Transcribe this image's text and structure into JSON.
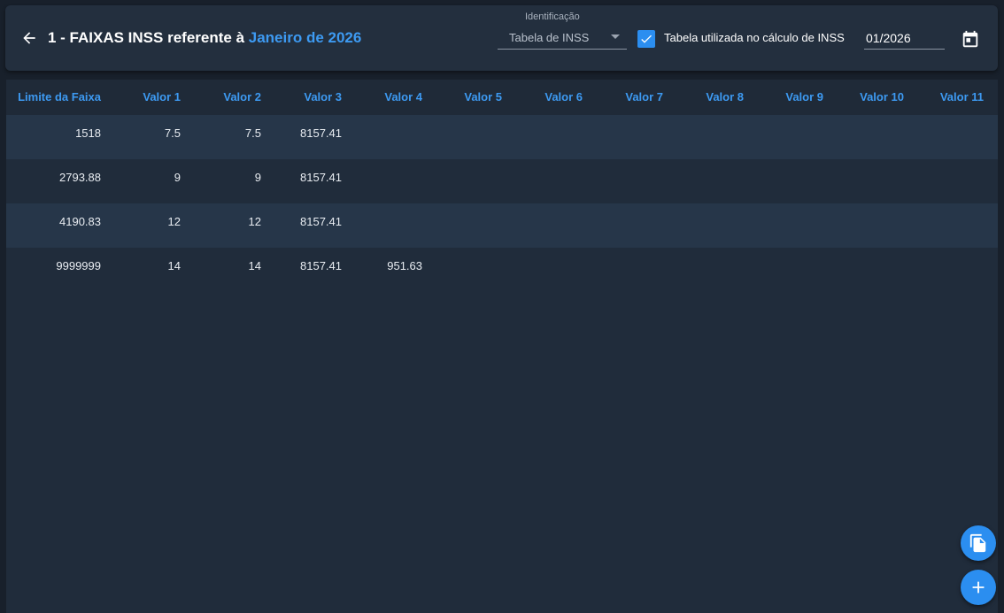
{
  "header": {
    "title_prefix": "1 - FAIXAS INSS referente à",
    "title_period": "Janeiro de 2026",
    "identificacao_label": "Identificação",
    "identificacao_value": "Tabela de INSS",
    "checkbox_checked": true,
    "checkbox_label": "Tabela utilizada no cálculo de INSS",
    "date_value": "01/2026"
  },
  "table": {
    "columns": [
      "Limite da Faixa",
      "Valor 1",
      "Valor 2",
      "Valor 3",
      "Valor 4",
      "Valor 5",
      "Valor 6",
      "Valor 7",
      "Valor 8",
      "Valor 9",
      "Valor 10",
      "Valor 11"
    ],
    "rows": [
      [
        "1518",
        "7.5",
        "7.5",
        "8157.41",
        "",
        "",
        "",
        "",
        "",
        "",
        "",
        ""
      ],
      [
        "2793.88",
        "9",
        "9",
        "8157.41",
        "",
        "",
        "",
        "",
        "",
        "",
        "",
        ""
      ],
      [
        "4190.83",
        "12",
        "12",
        "8157.41",
        "",
        "",
        "",
        "",
        "",
        "",
        "",
        ""
      ],
      [
        "9999999",
        "14",
        "14",
        "8157.41",
        "951.63",
        "",
        "",
        "",
        "",
        "",
        "",
        ""
      ]
    ]
  },
  "icons": {
    "back": "arrow-left-icon",
    "calendar": "calendar-icon",
    "copy": "copy-icon",
    "add": "plus-icon"
  },
  "colors": {
    "accent": "#3d9af2",
    "button": "#2b8ef0",
    "header_bg": "#232f3e",
    "row_odd": "#263649",
    "row_even": "#202c3b"
  }
}
